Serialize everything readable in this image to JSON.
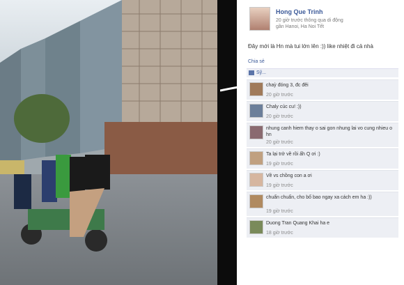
{
  "profile": {
    "name": "Hong Que Trinh",
    "meta_line1": "20 giờ trước thông qua di động",
    "meta_line2": "gần Hanoi, Ha Noi Tết"
  },
  "post": {
    "text": "Đây mới là Hn mà tui lớn lên :)) like nhiệt đi cả nhà",
    "share_label": "Chia sẻ",
    "like_label": "Sỹ..."
  },
  "comments": [
    {
      "text": "chaỳ đóng 3, đc đêi",
      "time": "20 giờ trước"
    },
    {
      "text": "Chaly cúc cu! :))",
      "time": "20 giờ trước"
    },
    {
      "text": "nhung canh hiem thay o sai gon nhung lai vo cung nhieu o hn",
      "time": "20 giờ trước"
    },
    {
      "text": "Ta lại trở về rồi ấh Q ơi :)",
      "time": "19 giờ trước"
    },
    {
      "text": "Về vs chồng con a ơi",
      "time": "19 giờ trước"
    },
    {
      "text": "chuẩn chuẩn, cho bố bao ngay xa cách em ha :))",
      "time": "19 giờ trước"
    },
    {
      "text": "Duong Tran Quang Khai ha e",
      "time": "18 giờ trước"
    }
  ]
}
